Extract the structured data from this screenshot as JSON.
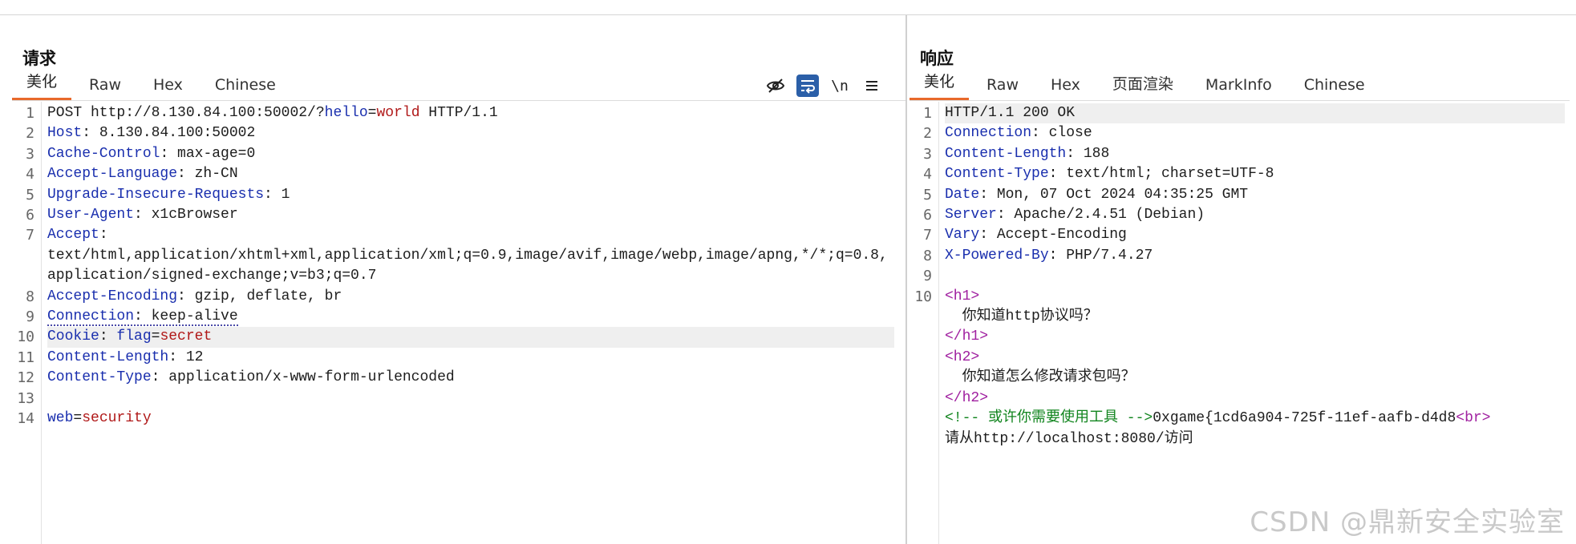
{
  "request": {
    "title": "请求",
    "tabs": [
      "美化",
      "Raw",
      "Hex",
      "Chinese"
    ],
    "active_tab": "美化",
    "tools": {
      "hide_icon": "eye-off-icon",
      "wrap_icon": "word-wrap-icon",
      "newline_label": "\\n",
      "menu_icon": "menu-icon"
    },
    "line_numbers": [
      "1",
      "2",
      "3",
      "4",
      "5",
      "6",
      "7",
      "8",
      "9",
      "10",
      "11",
      "12",
      "13",
      "14"
    ],
    "lines": {
      "l1_a": "POST http://8.130.84.100:50002/?",
      "l1_k": "hello",
      "l1_eq": "=",
      "l1_v": "world",
      "l1_b": " HTTP/1.1",
      "l2_k": "Host",
      "l2_v": ": 8.130.84.100:50002",
      "l3_k": "Cache-Control",
      "l3_v": ": max-age=0",
      "l4_k": "Accept-Language",
      "l4_v": ": zh-CN",
      "l5_k": "Upgrade-Insecure-Requests",
      "l5_v": ": 1",
      "l6_k": "User-Agent",
      "l6_v": ": x1cBrowser",
      "l7_k": "Accept",
      "l7_v": ":",
      "l7_wrap": "text/html,application/xhtml+xml,application/xml;q=0.9,image/avif,image/webp,image/apng,*/*;q=0.8,application/signed-exchange;v=b3;q=0.7",
      "l8_k": "Accept-Encoding",
      "l8_v": ": gzip, deflate, br",
      "l9_k": "Connection",
      "l9_v": ": keep-alive",
      "l10_k": "Cookie",
      "l10_sep": ": ",
      "l10_k2": "flag",
      "l10_eq": "=",
      "l10_v": "secret",
      "l11_k": "Content-Length",
      "l11_v": ": 12",
      "l12_k": "Content-Type",
      "l12_v": ": application/x-www-form-urlencoded",
      "l14_k": "web",
      "l14_eq": "=",
      "l14_v": "security"
    }
  },
  "response": {
    "title": "响应",
    "tabs": [
      "美化",
      "Raw",
      "Hex",
      "页面渲染",
      "MarkInfo",
      "Chinese"
    ],
    "active_tab": "美化",
    "line_numbers": [
      "1",
      "2",
      "3",
      "4",
      "5",
      "6",
      "7",
      "8",
      "9",
      "10"
    ],
    "lines": {
      "l1": "HTTP/1.1 200 OK",
      "l2_k": "Connection",
      "l2_v": ": close",
      "l3_k": "Content-Length",
      "l3_v": ": 188",
      "l4_k": "Content-Type",
      "l4_v": ": text/html; charset=UTF-8",
      "l5_k": "Date",
      "l5_v": ": Mon, 07 Oct 2024 04:35:25 GMT",
      "l6_k": "Server",
      "l6_v": ": Apache/2.4.51 (Debian)",
      "l7_k": "Vary",
      "l7_v": ": Accept-Encoding",
      "l8_k": "X-Powered-By",
      "l8_v": ": PHP/7.4.27",
      "h1_open": "<h1>",
      "h1_text": "  你知道http协议吗？",
      "h1_close": "</h1>",
      "h2_open": "<h2>",
      "h2_text": "  你知道怎么修改请求包吗？",
      "h2_close": "</h2>",
      "comment": "<!-- 或许你需要使用工具 -->",
      "flag": "0xgame{1cd6a904-725f-11ef-aafb-d4d8",
      "br": "<br>",
      "last": "请从http://localhost:8080/访问"
    }
  },
  "watermark": "CSDN @鼎新安全实验室"
}
